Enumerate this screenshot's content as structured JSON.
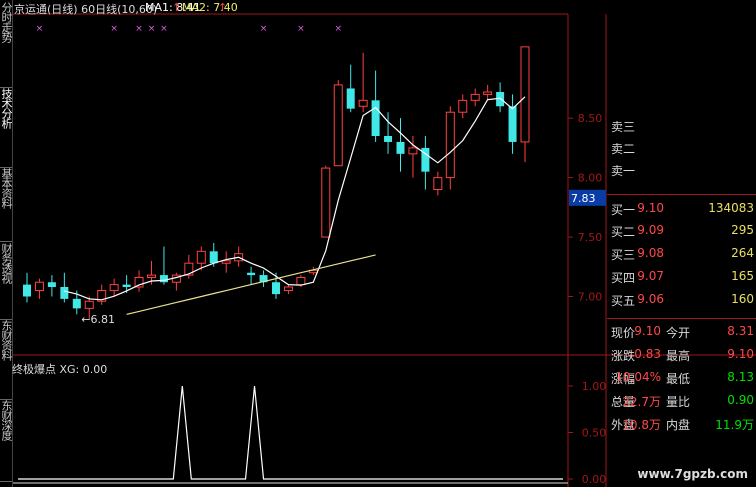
{
  "header": {
    "stock_title": "京运通(日线) 60日线(10,60)",
    "ma1": "MA1: 8.41",
    "ma2": "MA2: 7.40",
    "up_arrow": "↑"
  },
  "sidebar_tabs": [
    "分时走势",
    "技术分析",
    "基本资料",
    "财务透视",
    "东财资料",
    "东财深度"
  ],
  "price_axis": [
    "8.50",
    "8.00",
    "7.50",
    "7.00"
  ],
  "current_price_tag": "7.83",
  "low_annotation": "←6.81",
  "indicator": {
    "title": "终极爆点 XG: 0.00",
    "axis": [
      "1.00",
      "0.50",
      "0.00"
    ]
  },
  "order_book": {
    "sell": [
      {
        "label": "卖三",
        "price": "",
        "vol": ""
      },
      {
        "label": "卖二",
        "price": "",
        "vol": ""
      },
      {
        "label": "卖一",
        "price": "",
        "vol": ""
      }
    ],
    "buy": [
      {
        "label": "买一",
        "price": "9.10",
        "vol": "134083"
      },
      {
        "label": "买二",
        "price": "9.09",
        "vol": "295"
      },
      {
        "label": "买三",
        "price": "9.08",
        "vol": "264"
      },
      {
        "label": "买四",
        "price": "9.07",
        "vol": "165"
      },
      {
        "label": "买五",
        "price": "9.06",
        "vol": "160"
      }
    ]
  },
  "quote": [
    {
      "l1": "现价",
      "v1": "9.10",
      "l2": "今开",
      "v2": "8.31",
      "c2": "#ff4848"
    },
    {
      "l1": "涨跌",
      "v1": "0.83",
      "l2": "最高",
      "v2": "9.10",
      "c2": "#ff4848"
    },
    {
      "l1": "涨幅",
      "v1": "10.04%",
      "l2": "最低",
      "v2": "8.13",
      "c2": "#00e000"
    },
    {
      "l1": "总量",
      "v1": "22.7万",
      "l2": "量比",
      "v2": "0.90",
      "c2": "#00e000"
    },
    {
      "l1": "外盘",
      "v1": "10.8万",
      "l2": "内盘",
      "v2": "11.9万",
      "c2": "#00e000"
    }
  ],
  "watermark": "www.7gpzb.com",
  "colors": {
    "up": "#ff4040",
    "down": "#40e8e8",
    "ma1": "#ffffff",
    "ma2": "#e8e090",
    "grid_red": "#a01818",
    "marker": "#e060e0",
    "title_yellow": "#f0f060"
  },
  "chart_data": {
    "type": "candlestick",
    "title": "京运通(日线) 60日线(10,60)",
    "y_axis": [
      7.0,
      7.5,
      8.0,
      8.5
    ],
    "candles_ohlc": [
      [
        7.1,
        7.2,
        6.95,
        7.0
      ],
      [
        7.05,
        7.15,
        6.98,
        7.12
      ],
      [
        7.12,
        7.18,
        7.0,
        7.08
      ],
      [
        7.08,
        7.2,
        6.95,
        6.98
      ],
      [
        6.98,
        7.05,
        6.85,
        6.9
      ],
      [
        6.9,
        7.0,
        6.81,
        6.96
      ],
      [
        6.96,
        7.1,
        6.93,
        7.05
      ],
      [
        7.05,
        7.15,
        7.0,
        7.1
      ],
      [
        7.1,
        7.18,
        7.03,
        7.08
      ],
      [
        7.08,
        7.22,
        7.04,
        7.16
      ],
      [
        7.16,
        7.3,
        7.1,
        7.18
      ],
      [
        7.18,
        7.42,
        7.1,
        7.12
      ],
      [
        7.12,
        7.2,
        7.05,
        7.18
      ],
      [
        7.18,
        7.35,
        7.15,
        7.28
      ],
      [
        7.28,
        7.42,
        7.22,
        7.38
      ],
      [
        7.38,
        7.45,
        7.25,
        7.28
      ],
      [
        7.28,
        7.38,
        7.2,
        7.3
      ],
      [
        7.3,
        7.42,
        7.25,
        7.36
      ],
      [
        7.2,
        7.25,
        7.1,
        7.18
      ],
      [
        7.18,
        7.22,
        7.08,
        7.12
      ],
      [
        7.12,
        7.2,
        6.98,
        7.02
      ],
      [
        7.05,
        7.1,
        7.02,
        7.08
      ],
      [
        7.1,
        7.18,
        7.08,
        7.16
      ],
      [
        7.2,
        7.25,
        7.18,
        7.22
      ],
      [
        7.5,
        8.1,
        7.5,
        8.08
      ],
      [
        8.1,
        8.82,
        8.1,
        8.78
      ],
      [
        8.75,
        8.95,
        8.55,
        8.58
      ],
      [
        8.6,
        9.05,
        8.55,
        8.65
      ],
      [
        8.65,
        8.9,
        8.3,
        8.35
      ],
      [
        8.35,
        8.55,
        8.2,
        8.3
      ],
      [
        8.3,
        8.5,
        8.05,
        8.2
      ],
      [
        8.2,
        8.35,
        8.0,
        8.25
      ],
      [
        8.25,
        8.35,
        7.9,
        8.05
      ],
      [
        7.9,
        8.05,
        7.85,
        8.0
      ],
      [
        8.0,
        8.6,
        7.9,
        8.55
      ],
      [
        8.55,
        8.7,
        8.5,
        8.65
      ],
      [
        8.65,
        8.75,
        8.6,
        8.7
      ],
      [
        8.7,
        8.78,
        8.65,
        8.72
      ],
      [
        8.72,
        8.8,
        8.55,
        8.6
      ],
      [
        8.6,
        8.7,
        8.2,
        8.3
      ],
      [
        8.3,
        9.1,
        8.13,
        9.1
      ]
    ],
    "indicator_series": {
      "name": "终极爆点 XG",
      "values": [
        0,
        0,
        0,
        0,
        0,
        0,
        0,
        0,
        0,
        0,
        0,
        0,
        1,
        0,
        0,
        0,
        0,
        0,
        0,
        0,
        0,
        0,
        1,
        0,
        0,
        0,
        0,
        0,
        0,
        0,
        0,
        0,
        0,
        0,
        0,
        0,
        0,
        0,
        0,
        0,
        0
      ],
      "ylim": [
        0,
        1
      ]
    }
  }
}
